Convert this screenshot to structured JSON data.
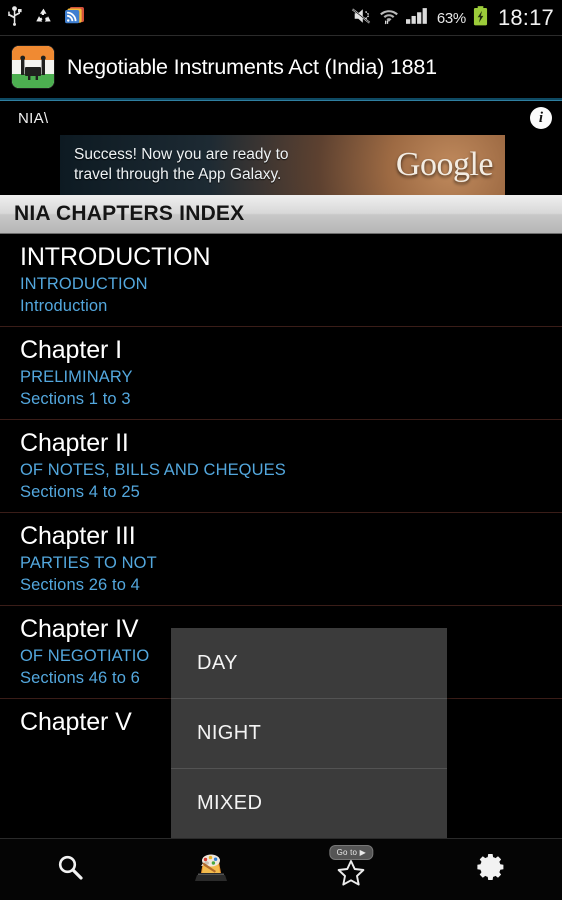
{
  "status_bar": {
    "icons_left": [
      "usb-icon",
      "sync-recycle-icon",
      "google-currents-icon"
    ],
    "icons_right": [
      "mute-vibrate-icon",
      "wifi-icon",
      "signal-bars-icon"
    ],
    "battery_percent": "63%",
    "battery_state": "charging",
    "time": "18:17"
  },
  "title_bar": {
    "app_icon": "india-flag-emblem-icon",
    "title": "Negotiable Instruments Act (India) 1881"
  },
  "breadcrumb": {
    "path": "NIA\\",
    "info_label": "i"
  },
  "ad": {
    "line1": "Success! Now you are ready to",
    "line2": "travel through the App Galaxy.",
    "brand": "Google"
  },
  "section_header": {
    "title": "NIA CHAPTERS INDEX"
  },
  "chapters": [
    {
      "title": "INTRODUCTION",
      "subtitle": "INTRODUCTION",
      "sections": "Introduction"
    },
    {
      "title": "Chapter I",
      "subtitle": "PRELIMINARY",
      "sections": "Sections 1 to 3"
    },
    {
      "title": "Chapter II",
      "subtitle": "OF NOTES, BILLS AND CHEQUES",
      "sections": "Sections 4 to 25"
    },
    {
      "title": "Chapter III",
      "subtitle": "PARTIES TO NOT",
      "sections": "Sections 26 to 4"
    },
    {
      "title": "Chapter IV",
      "subtitle": "OF NEGOTIATIO",
      "sections": "Sections 46 to 6"
    },
    {
      "title": "Chapter V",
      "subtitle": "",
      "sections": ""
    }
  ],
  "popup_menu": {
    "items": [
      {
        "label": "DAY"
      },
      {
        "label": "NIGHT"
      },
      {
        "label": "MIXED"
      }
    ]
  },
  "toolbar": {
    "search_icon": "search-icon",
    "theme_icon": "palette-icon",
    "bookmark_icon": "star-icon",
    "bookmark_tooltip": "Go to ▶",
    "settings_icon": "gear-icon"
  },
  "colors": {
    "background": "#000000",
    "accent_blue": "#53a7dd",
    "divider_red": "#3a1d18",
    "popup_bg": "#3b3b3b",
    "section_bar": "#d8d8d8"
  }
}
